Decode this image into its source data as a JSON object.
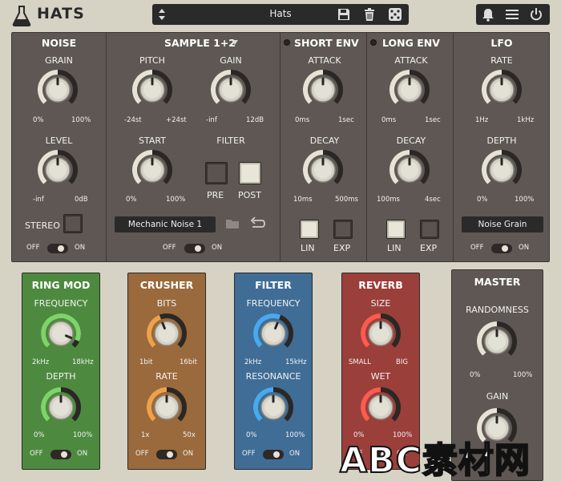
{
  "header": {
    "title": "HATS",
    "preset_name": "Hats"
  },
  "noise": {
    "title": "NOISE",
    "grain": {
      "label": "GRAIN",
      "min": "0%",
      "max": "100%",
      "value": 0.5
    },
    "level": {
      "label": "LEVEL",
      "min": "-inf",
      "max": "0dB",
      "value": 0.5
    },
    "stereo_label": "STEREO",
    "off": "OFF",
    "on": "ON"
  },
  "sample": {
    "title": "SAMPLE 1+2",
    "pitch": {
      "label": "PITCH",
      "min": "-24st",
      "max": "+24st",
      "value": 0.5
    },
    "gain": {
      "label": "GAIN",
      "min": "-inf",
      "max": "12dB",
      "value": 0.5
    },
    "start": {
      "label": "START",
      "min": "0%",
      "max": "100%",
      "value": 0.5
    },
    "filter_label": "FILTER",
    "pre": "PRE",
    "post": "POST",
    "sample_name": "Mechanic Noise 1",
    "off": "OFF",
    "on": "ON"
  },
  "short_env": {
    "title": "SHORT ENV",
    "attack": {
      "label": "ATTACK",
      "min": "0ms",
      "max": "1sec",
      "value": 0.5
    },
    "decay": {
      "label": "DECAY",
      "min": "10ms",
      "max": "500ms",
      "value": 0.5
    },
    "lin": "LIN",
    "exp": "EXP"
  },
  "long_env": {
    "title": "LONG ENV",
    "attack": {
      "label": "ATTACK",
      "min": "0ms",
      "max": "1sec",
      "value": 0.5
    },
    "decay": {
      "label": "DECAY",
      "min": "100ms",
      "max": "4sec",
      "value": 0.5
    },
    "lin": "LIN",
    "exp": "EXP"
  },
  "lfo": {
    "title": "LFO",
    "rate": {
      "label": "RATE",
      "min": "1Hz",
      "max": "1kHz",
      "value": 0.5
    },
    "depth": {
      "label": "DEPTH",
      "min": "0%",
      "max": "100%",
      "value": 0.5
    },
    "target": "Noise Grain",
    "off": "OFF",
    "on": "ON"
  },
  "ring_mod": {
    "title": "RING MOD",
    "frequency": {
      "label": "FREQUENCY",
      "min": "2kHz",
      "max": "18kHz",
      "value": 0.92
    },
    "depth": {
      "label": "DEPTH",
      "min": "0%",
      "max": "100%",
      "value": 0.5
    },
    "off": "OFF",
    "on": "ON"
  },
  "crusher": {
    "title": "CRUSHER",
    "bits": {
      "label": "BITS",
      "min": "1bit",
      "max": "16bit",
      "value": 0.42
    },
    "rate": {
      "label": "RATE",
      "min": "1x",
      "max": "50x",
      "value": 0.5
    },
    "off": "OFF",
    "on": "ON"
  },
  "filter": {
    "title": "FILTER",
    "frequency": {
      "label": "FREQUENCY",
      "min": "2kHz",
      "max": "15kHz",
      "value": 0.58
    },
    "resonance": {
      "label": "RESONANCE",
      "min": "0%",
      "max": "100%",
      "value": 0.5
    },
    "off": "OFF",
    "on": "ON"
  },
  "reverb": {
    "title": "REVERB",
    "size": {
      "label": "SIZE",
      "min": "SMALL",
      "max": "BIG",
      "value": 0.5
    },
    "wet": {
      "label": "WET",
      "min": "0%",
      "max": "100%",
      "value": 0.5
    },
    "off": "OFF",
    "on": "ON"
  },
  "master": {
    "title": "MASTER",
    "randomness": {
      "label": "RANDOMNESS",
      "min": "0%",
      "max": "100%",
      "value": 0.5
    },
    "gain": {
      "label": "GAIN",
      "value": 0.5
    }
  },
  "watermark": "ABC素材网",
  "colors": {
    "ring_mod": "#4d8a3f",
    "crusher": "#9a6a3c",
    "filter": "#3f6d96",
    "reverb": "#9a3f3a",
    "ring_mod_arc": "#7ed36a",
    "crusher_arc": "#f0a04a",
    "filter_arc": "#49a9ee",
    "reverb_arc": "#ff5a4e",
    "track": "#2b2725"
  },
  "icons": [
    "flask-icon",
    "updown-arrows-icon",
    "save-icon",
    "trash-icon",
    "dice-icon",
    "bell-icon",
    "menu-icon",
    "power-icon",
    "folder-icon",
    "loop-icon"
  ]
}
